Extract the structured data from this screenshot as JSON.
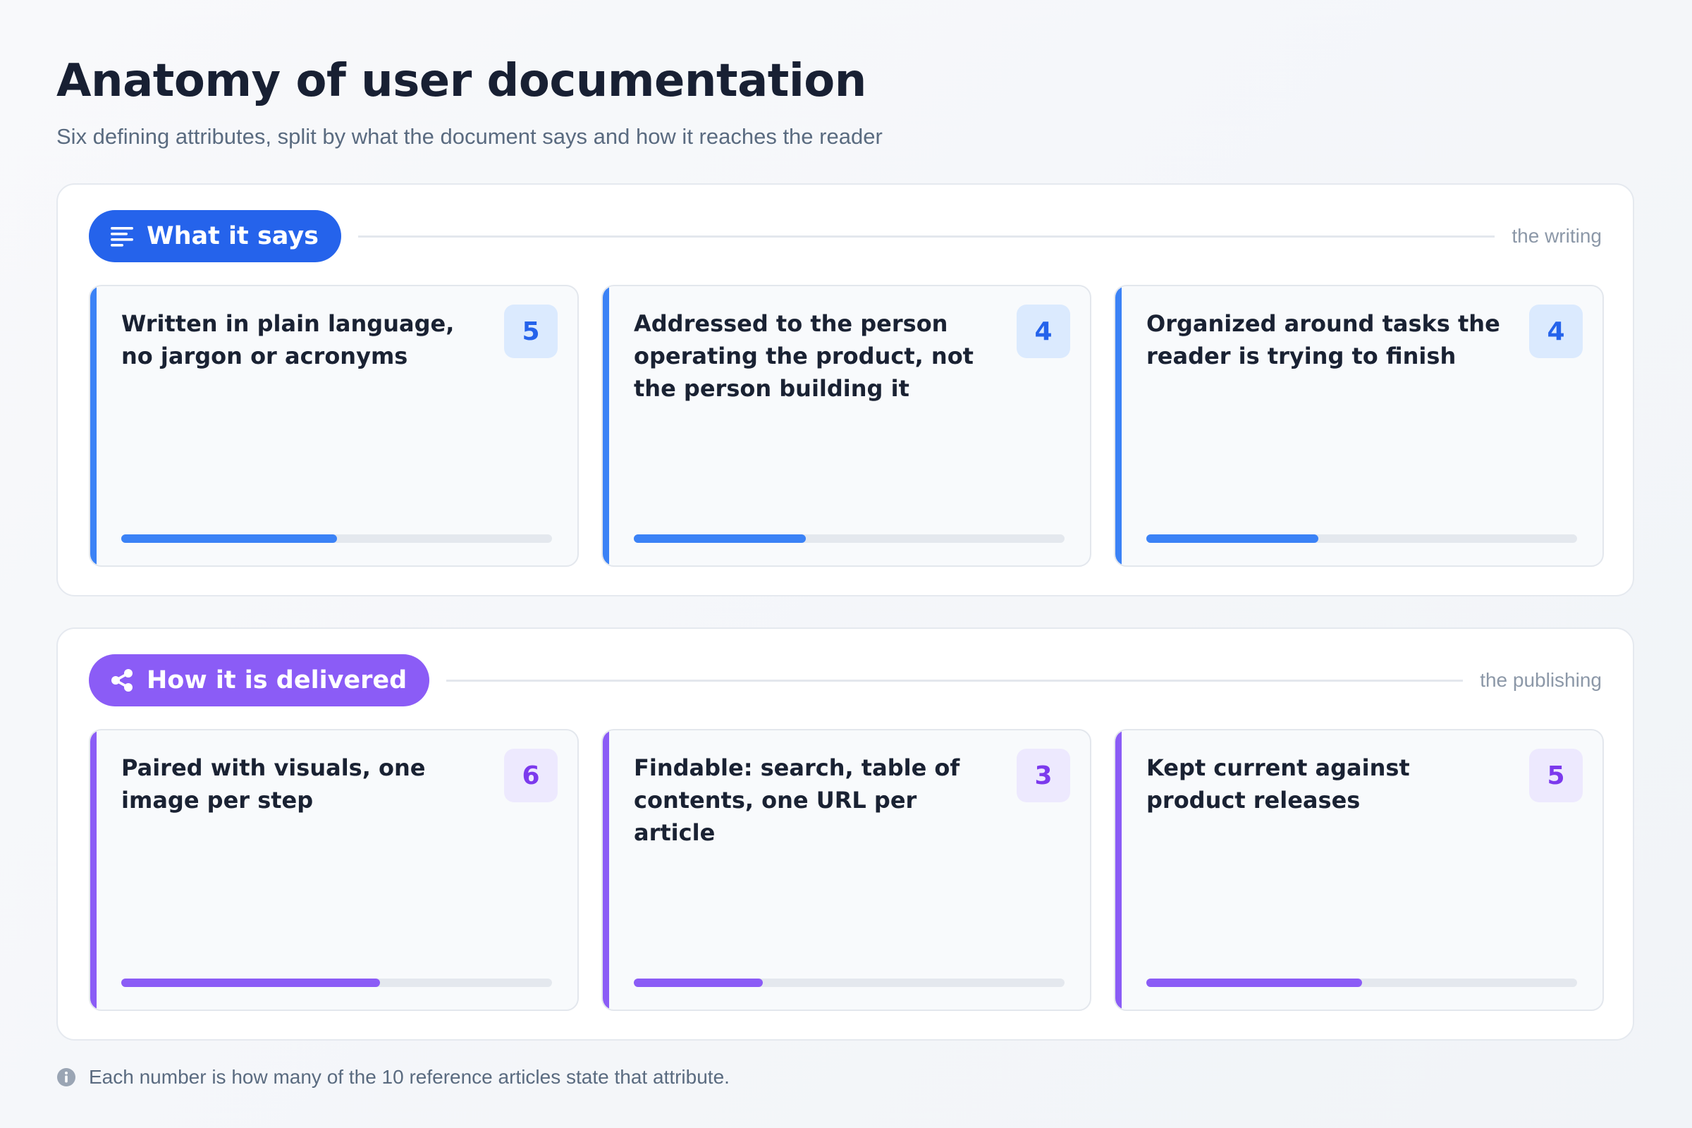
{
  "header": {
    "title": "Anatomy of user documentation",
    "subtitle": "Six defining attributes, split by what the document says and how it reaches the reader"
  },
  "sections": [
    {
      "label": "What it says",
      "icon": "text-lines-icon",
      "tag": "the writing",
      "color": "#2563eb",
      "cards": [
        {
          "text": "Written in plain language, no jargon or acronyms",
          "count": "5",
          "value": 5
        },
        {
          "text": "Addressed to the person operating the product, not the person building it",
          "count": "4",
          "value": 4
        },
        {
          "text": "Organized around tasks the reader is trying to finish",
          "count": "4",
          "value": 4
        }
      ]
    },
    {
      "label": "How it is delivered",
      "icon": "share-icon",
      "tag": "the publishing",
      "color": "#8b5cf6",
      "cards": [
        {
          "text": "Paired with visuals, one image per step",
          "count": "6",
          "value": 6
        },
        {
          "text": "Findable: search, table of contents, one URL per article",
          "count": "3",
          "value": 3
        },
        {
          "text": "Kept current against product releases",
          "count": "5",
          "value": 5
        }
      ]
    }
  ],
  "scale_max": 10,
  "footnote": {
    "icon": "info-icon",
    "text": "Each number is how many of the 10 reference articles state that attribute."
  }
}
